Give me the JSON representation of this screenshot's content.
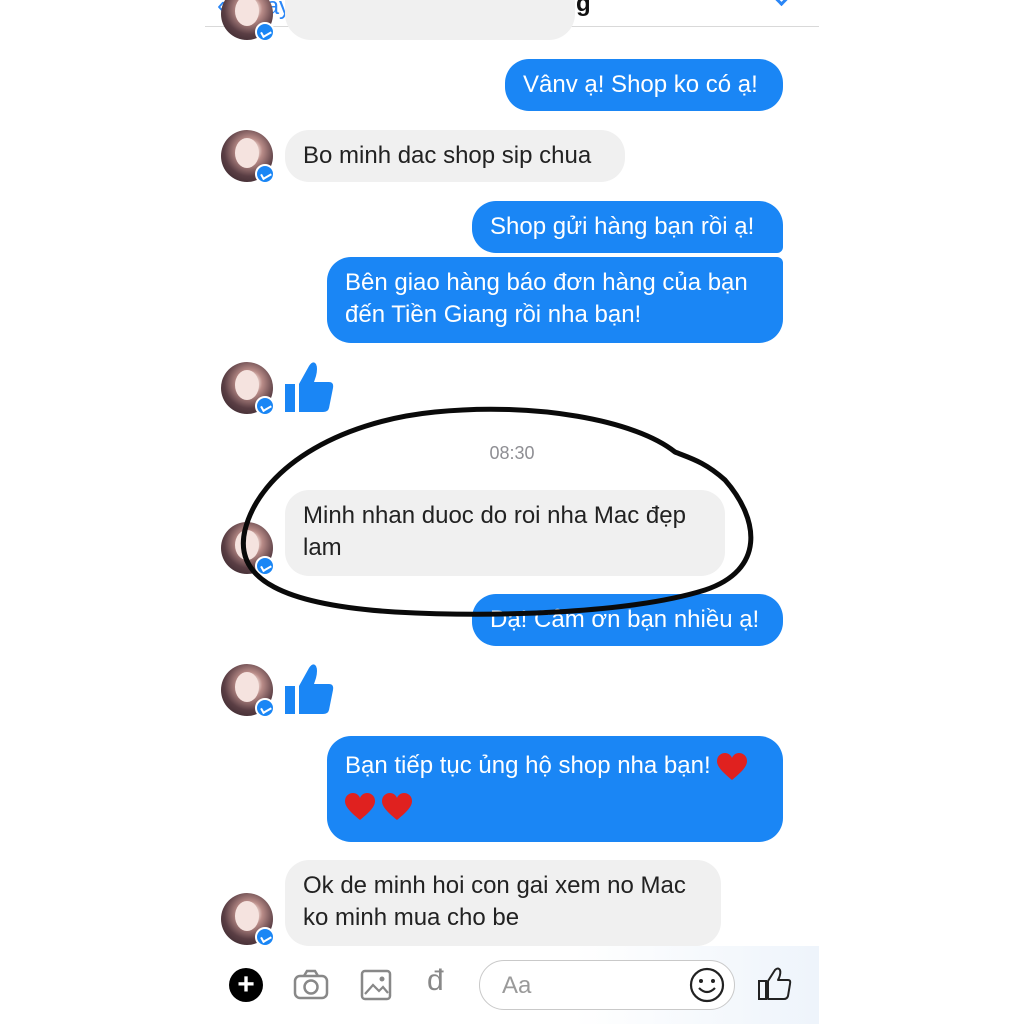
{
  "header": {
    "back_label": "Quay lại",
    "title": "Nhung Hoang"
  },
  "messages": {
    "m1": "Vânv ạ! Shop ko có ạ!",
    "m2": "Bo minh dac shop sip chua",
    "m3": "Shop gửi hàng bạn rồi ạ!",
    "m4_line1": "Bên giao hàng báo đơn hàng của bạn",
    "m4_line2": "đến Tiền Giang rồi nha bạn!",
    "timestamp": "08:30",
    "m5_line1": "Minh nhan duoc do roi nha Mac đẹp",
    "m5_line2": "lam",
    "m6": "Dạ! Cảm ơn bạn nhiều ạ!",
    "m7_line1": "Bạn tiếp tục ủng hộ shop nha bạn!",
    "m8_line1": "Ok de minh hoi con gai xem no Mac",
    "m8_line2": "ko minh mua cho be"
  },
  "composer": {
    "placeholder": "Aa",
    "currency_symbol": "đ"
  },
  "icons": {
    "plus": "plus-circle-icon",
    "camera": "camera-icon",
    "gallery": "image-icon",
    "payment": "dong-icon",
    "emoji": "smiley-icon",
    "like": "thumbs-up-icon",
    "heart": "heart-icon"
  },
  "colors": {
    "outgoing_bubble": "#1a86f5",
    "incoming_bubble": "#f0f0f0",
    "accent": "#2a86f6",
    "heart": "#e0211f"
  }
}
